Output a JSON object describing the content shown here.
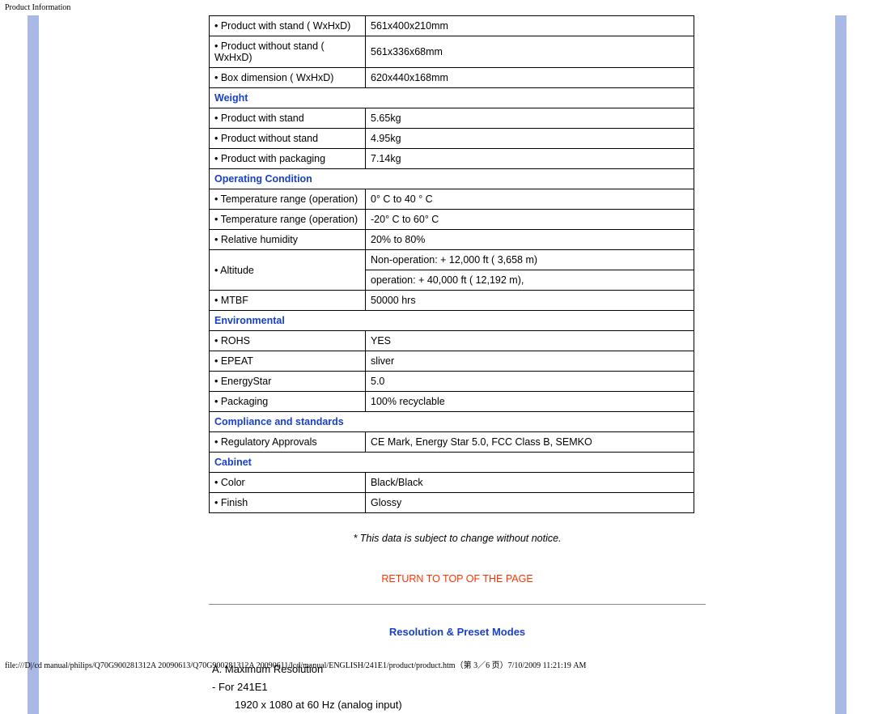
{
  "header": "Product Information",
  "specRows": [
    {
      "label": "• Product with stand ( WxHxD)",
      "value": "561x400x210mm"
    },
    {
      "label": "• Product without stand ( WxHxD)",
      "value": "561x336x68mm"
    },
    {
      "label": "• Box dimension ( WxHxD)",
      "value": "620x440x168mm"
    },
    {
      "header": "Weight"
    },
    {
      "label": "• Product with stand",
      "value": "5.65kg"
    },
    {
      "label": "• Product without stand",
      "value": "4.95kg"
    },
    {
      "label": "• Product with packaging",
      "value": "7.14kg"
    },
    {
      "header": "Operating Condition"
    },
    {
      "label": "• Temperature range (operation)",
      "value": "0° C to 40 ° C"
    },
    {
      "label": "• Temperature range (operation)",
      "value": "-20° C to 60° C"
    },
    {
      "label": "• Relative humidity",
      "value": "20% to 80%"
    },
    {
      "label": "• Altitude",
      "values": [
        "Non-operation: + 12,000 ft ( 3,658 m)",
        "operation: + 40,000 ft ( 12,192 m),"
      ],
      "rowspan": 2
    },
    {
      "label": "• MTBF",
      "value": "50000 hrs"
    },
    {
      "header": "Environmental"
    },
    {
      "label": "• ROHS",
      "value": "YES"
    },
    {
      "label": "• EPEAT",
      "value": "sliver"
    },
    {
      "label": "• EnergyStar",
      "value": "5.0"
    },
    {
      "label": "• Packaging",
      "value": "100% recyclable"
    },
    {
      "header": "Compliance and standards"
    },
    {
      "label": "• Regulatory Approvals",
      "value": "CE Mark, Energy Star 5.0, FCC Class B, SEMKO"
    },
    {
      "header": "Cabinet"
    },
    {
      "label": "• Color",
      "value": "Black/Black"
    },
    {
      "label": "• Finish",
      "value": "Glossy"
    }
  ],
  "notice": "* This data is subject to change without notice.",
  "returnLink": "RETURN TO TOP OF THE PAGE",
  "resolutionTitle": "Resolution & Preset Modes",
  "resolution": {
    "lineA": "A.   Maximum Resolution",
    "lineB": "-    For 241E1",
    "lineC": "1920 x 1080 at 60 Hz (analog input)"
  },
  "footer": "file:///D|/cd manual/philips/Q70G900281312A 20090613/Q70G900281312A 20090611/lcd/manual/ENGLISH/241E1/product/product.htm（第 3／6 页）7/10/2009 11:21:19 AM"
}
